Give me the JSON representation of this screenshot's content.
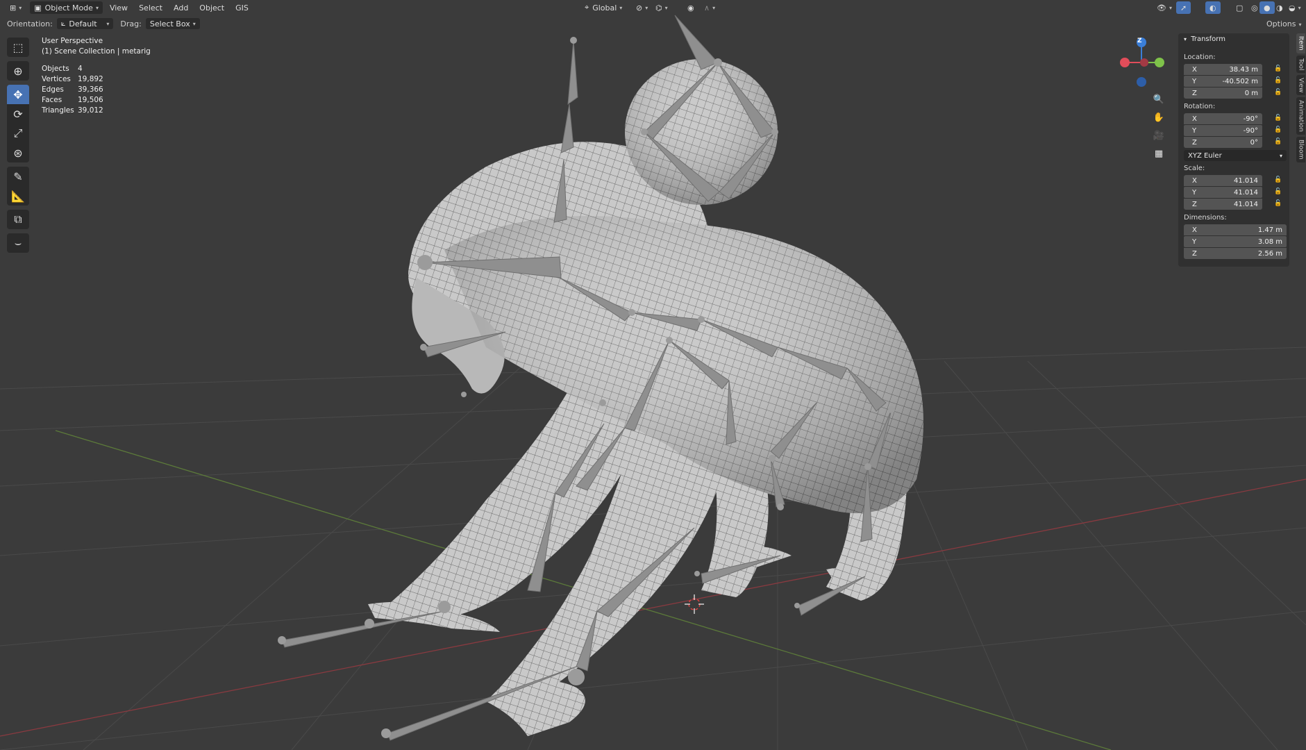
{
  "header": {
    "editor_icon": "viewport-icon",
    "mode": "Object Mode",
    "menus": [
      "View",
      "Select",
      "Add",
      "Object",
      "GIS"
    ],
    "orientation_transform": "Global",
    "options_label": "Options"
  },
  "tool_settings": {
    "orientation_label": "Orientation:",
    "orientation_value": "Default",
    "drag_label": "Drag:",
    "drag_value": "Select Box"
  },
  "overlay": {
    "view_name": "User Perspective",
    "collection": "(1) Scene Collection | metarig",
    "stats": [
      {
        "label": "Objects",
        "value": "4"
      },
      {
        "label": "Vertices",
        "value": "19,892"
      },
      {
        "label": "Edges",
        "value": "39,366"
      },
      {
        "label": "Faces",
        "value": "19,506"
      },
      {
        "label": "Triangles",
        "value": "39,012"
      }
    ]
  },
  "toolbar": {
    "tools": [
      "select-box-icon",
      "cursor-icon",
      "move-icon",
      "rotate-icon",
      "scale-icon",
      "transform-icon",
      "annotate-icon",
      "measure-icon",
      "add-cube-icon",
      "add-bone-icon"
    ],
    "active": "move-icon"
  },
  "gizmo": {
    "z_label": "Z",
    "colors": {
      "x": "#e24d5a",
      "y": "#7fc24a",
      "z": "#3a7ed8"
    }
  },
  "npanel": {
    "title": "Transform",
    "location_label": "Location:",
    "location": {
      "x": "38.43 m",
      "y": "-40.502 m",
      "z": "0 m"
    },
    "rotation_label": "Rotation:",
    "rotation": {
      "x": "-90°",
      "y": "-90°",
      "z": "0°"
    },
    "rotation_mode": "XYZ Euler",
    "scale_label": "Scale:",
    "scale": {
      "x": "41.014",
      "y": "41.014",
      "z": "41.014"
    },
    "dimensions_label": "Dimensions:",
    "dimensions": {
      "x": "1.47 m",
      "y": "3.08 m",
      "z": "2.56 m"
    },
    "axis_labels": {
      "x": "X",
      "y": "Y",
      "z": "Z"
    }
  },
  "side_tabs": [
    "Item",
    "Tool",
    "View",
    "Animation",
    "Bloom"
  ],
  "colors": {
    "accent": "#4772b3",
    "background": "#3b3b3b"
  }
}
